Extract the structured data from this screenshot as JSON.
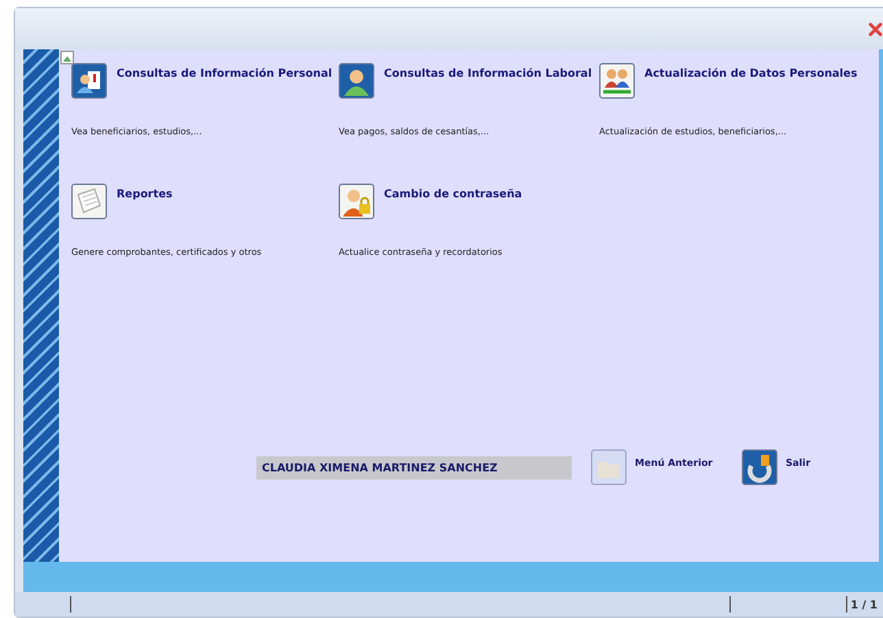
{
  "options": [
    {
      "kind": "personal",
      "title": "Consultas de Información Personal",
      "description": "Vea beneficiarios, estudios,..."
    },
    {
      "kind": "laboral",
      "title": "Consultas de Información Laboral",
      "description": "Vea pagos, saldos de cesantías,..."
    },
    {
      "kind": "update",
      "title": "Actualización de Datos Personales",
      "description": "Actualización de estudios, beneficiarios,..."
    },
    {
      "kind": "reports",
      "title": "Reportes",
      "description": "Genere comprobantes, certificados y otros"
    },
    {
      "kind": "password",
      "title": "Cambio de contraseña",
      "description": "Actualice contraseña y recordatorios"
    }
  ],
  "user_name": "CLAUDIA XIMENA MARTINEZ SANCHEZ",
  "actions": [
    {
      "kind": "back",
      "label": "Menú Anterior",
      "disabled": true
    },
    {
      "kind": "exit",
      "label": "Salir",
      "disabled": false
    }
  ],
  "status_bar": {
    "page": "1 / 1"
  }
}
